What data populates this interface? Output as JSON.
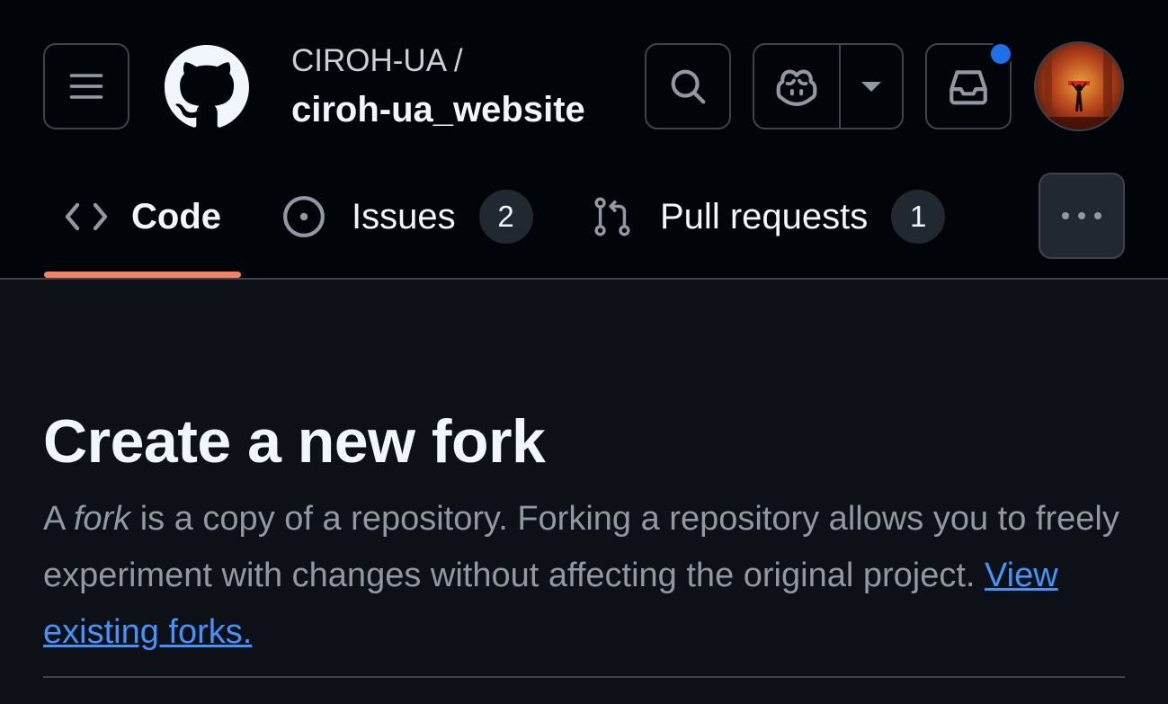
{
  "header": {
    "repo_owner": "CIROH-UA /",
    "repo_name": "ciroh-ua_website",
    "icons": [
      "hamburger-menu-icon",
      "github-logo-icon",
      "search-icon",
      "copilot-icon",
      "triangle-down-icon",
      "inbox-icon"
    ],
    "notification_dot_color": "#1f6feb"
  },
  "tabs": [
    {
      "label": "Code",
      "icon": "code-icon",
      "selected": true
    },
    {
      "label": "Issues",
      "icon": "issue-opened-icon",
      "count": "2"
    },
    {
      "label": "Pull requests",
      "icon": "git-pull-request-icon",
      "count": "1"
    }
  ],
  "main": {
    "title": "Create a new fork",
    "description": {
      "part1": "A ",
      "fork_word": "fork",
      "part2": " is a copy of a repository. Forking a repository allows you to freely experiment with changes without affecting the original project. ",
      "link_text": "View existing forks."
    }
  },
  "colors": {
    "header_bg": "#010409",
    "page_bg": "#0d1117",
    "accent_underline": "#f78166",
    "link": "#4493f8",
    "muted_text": "#9198a1"
  }
}
